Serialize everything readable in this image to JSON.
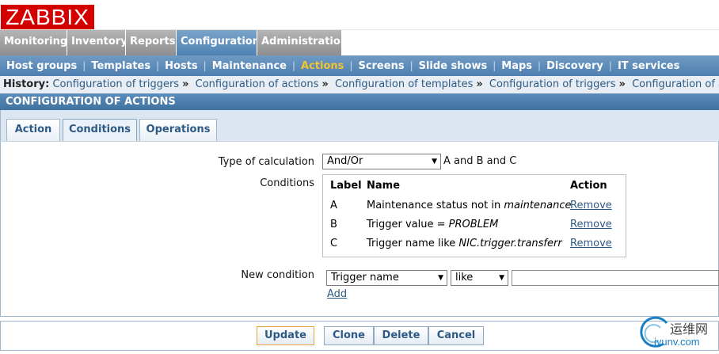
{
  "logo": "ZABBIX",
  "main_menu": [
    "Monitoring",
    "Inventory",
    "Reports",
    "Configuration",
    "Administration"
  ],
  "main_menu_active": "Configuration",
  "sub_menu": [
    "Host groups",
    "Templates",
    "Hosts",
    "Maintenance",
    "Actions",
    "Screens",
    "Slide shows",
    "Maps",
    "Discovery",
    "IT services"
  ],
  "sub_menu_active": "Actions",
  "history": {
    "label": "History:",
    "items": [
      "Configuration of triggers",
      "Configuration of actions",
      "Configuration of templates",
      "Configuration of triggers",
      "Configuration of actions"
    ]
  },
  "section_title": "CONFIGURATION OF ACTIONS",
  "tabs": [
    "Action",
    "Conditions",
    "Operations"
  ],
  "active_tab": "Conditions",
  "form": {
    "type_of_calculation_label": "Type of calculation",
    "type_of_calculation_value": "And/Or",
    "formula": "A and B and C",
    "conditions_label": "Conditions",
    "conditions_headers": {
      "label": "Label",
      "name": "Name",
      "action": "Action"
    },
    "conditions": [
      {
        "label": "A",
        "name_prefix": "Maintenance status not in ",
        "name_value": "maintenance",
        "action": "Remove"
      },
      {
        "label": "B",
        "name_prefix": "Trigger value = ",
        "name_value": "PROBLEM",
        "action": "Remove"
      },
      {
        "label": "C",
        "name_prefix": "Trigger name like ",
        "name_value": "NIC.trigger.transferr",
        "action": "Remove"
      }
    ],
    "new_condition_label": "New condition",
    "new_condition_type": "Trigger name",
    "new_condition_operator": "like",
    "new_condition_value": "",
    "add_label": "Add"
  },
  "buttons": {
    "update": "Update",
    "clone": "Clone",
    "delete": "Delete",
    "cancel": "Cancel"
  },
  "watermark": {
    "line1": "运维网",
    "line2": "iyunv.com"
  },
  "colors": {
    "logo_red": "#d40000",
    "menu_blue": "#4f80b1",
    "active_submenu": "#f4c430",
    "link": "#2d5a85"
  }
}
